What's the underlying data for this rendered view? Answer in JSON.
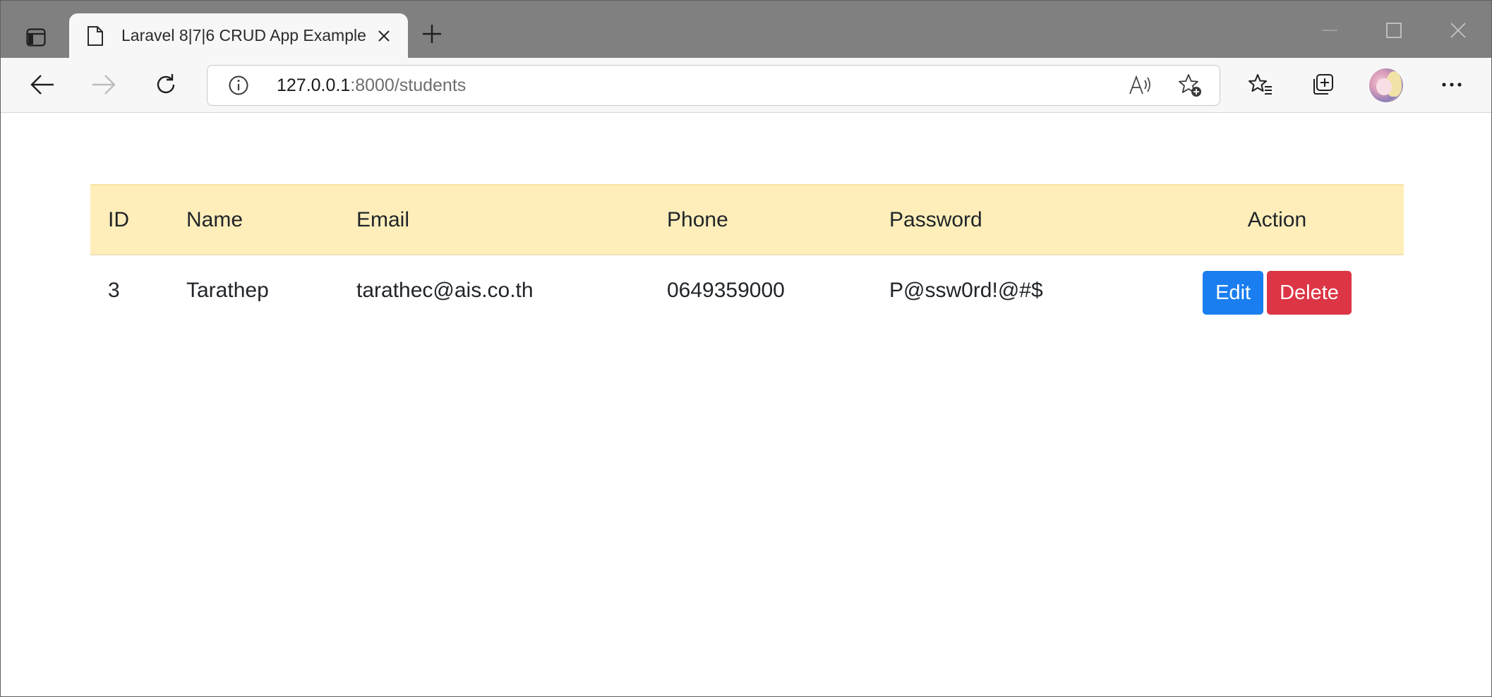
{
  "browser": {
    "tab": {
      "title": "Laravel 8|7|6 CRUD App Example"
    },
    "address": {
      "host": "127.0.0.1",
      "rest": ":8000/students"
    }
  },
  "table": {
    "headers": {
      "id": "ID",
      "name": "Name",
      "email": "Email",
      "phone": "Phone",
      "password": "Password",
      "action": "Action"
    },
    "rows": [
      {
        "id": "3",
        "name": "Tarathep",
        "email": "tarathec@ais.co.th",
        "phone": "0649359000",
        "password": "P@ssw0rd!@#$",
        "edit_label": "Edit",
        "delete_label": "Delete"
      }
    ]
  },
  "colors": {
    "header_bg": "#ffeeba",
    "edit_button": "#1a7ef0",
    "delete_button": "#dc3545",
    "tabstrip": "#808080"
  }
}
